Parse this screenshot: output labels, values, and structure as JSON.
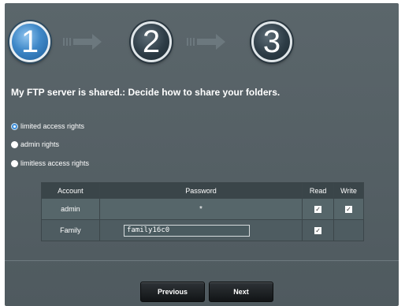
{
  "steps": [
    "1",
    "2",
    "3"
  ],
  "heading": "My FTP server is shared.: Decide how to share your folders.",
  "share_options": [
    {
      "label": "limited access rights",
      "selected": true
    },
    {
      "label": "admin rights",
      "selected": false
    },
    {
      "label": "limitless access rights",
      "selected": false
    }
  ],
  "table": {
    "headers": [
      "Account",
      "Password",
      "Read",
      "Write"
    ],
    "rows": [
      {
        "account": "admin",
        "password": "*",
        "read": true,
        "write": true
      },
      {
        "account": "Family",
        "password": "family16c0",
        "read": true,
        "write": false
      }
    ]
  },
  "buttons": {
    "previous": "Previous",
    "next": "Next"
  },
  "colors": {
    "active_step": "#3f88c8",
    "panel_bg": "#566166",
    "button_bg": "#1a1e21"
  }
}
